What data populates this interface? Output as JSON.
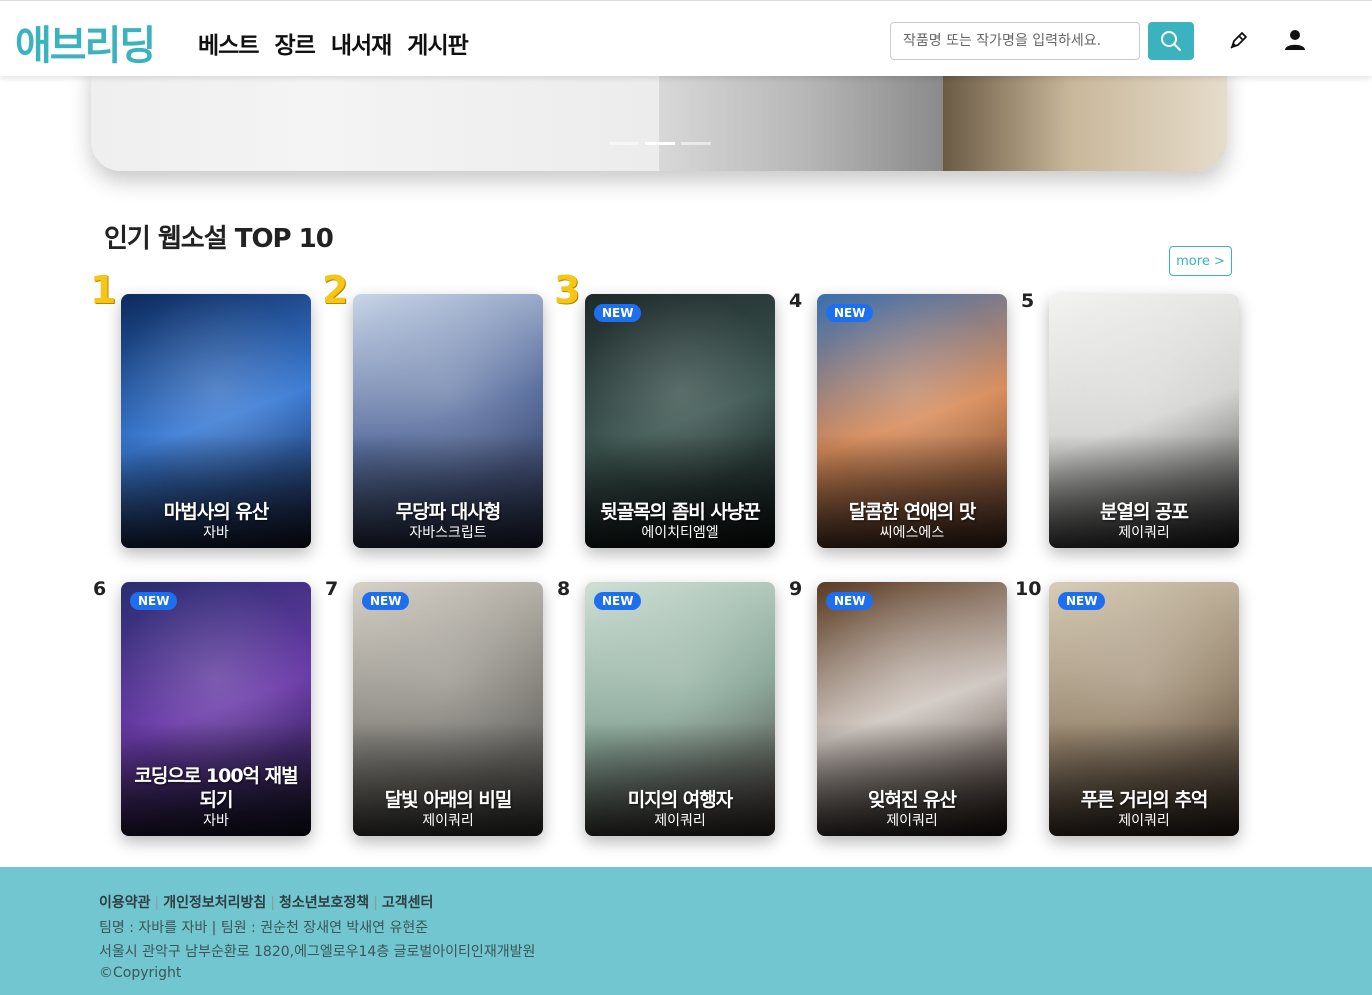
{
  "header": {
    "logo": "애브리딩",
    "nav": [
      "베스트",
      "장르",
      "내서재",
      "게시판"
    ],
    "search_placeholder": "작품명 또는 작가명을 입력하세요."
  },
  "colors": {
    "accent": "#3bb3bf",
    "badge": "#1e6ff0",
    "footer": "#72c6cf",
    "rank_gold": "#f5c518"
  },
  "section": {
    "title": "인기 웹소설 TOP 10",
    "more": "more >"
  },
  "books": [
    {
      "rank": "1",
      "title": "마법사의 유산",
      "author": "자바",
      "new": false,
      "cover": [
        "#0d2a5c",
        "#3a7bd5",
        "#1a1f3a"
      ]
    },
    {
      "rank": "2",
      "title": "무당파 대사형",
      "author": "자바스크립트",
      "new": false,
      "cover": [
        "#c9d6e8",
        "#5a6f9e",
        "#2c3550"
      ]
    },
    {
      "rank": "3",
      "title": "뒷골목의 좀비 사냥꾼",
      "author": "에이치티엠엘",
      "new": true,
      "cover": [
        "#1e2a2a",
        "#3c5550",
        "#141a1a"
      ]
    },
    {
      "rank": "4",
      "title": "달콤한 연애의 맛",
      "author": "씨에스에스",
      "new": true,
      "cover": [
        "#3a6fb0",
        "#d88c5a",
        "#5a3a2a"
      ]
    },
    {
      "rank": "5",
      "title": "분열의 공포",
      "author": "제이쿼리",
      "new": false,
      "cover": [
        "#f3f3f1",
        "#d4d4d2",
        "#2a2a2a"
      ]
    },
    {
      "rank": "6",
      "title": "코딩으로 100억 재벌 되기",
      "author": "자바",
      "new": true,
      "cover": [
        "#2a2d6e",
        "#6a3aa8",
        "#1a1a2e"
      ]
    },
    {
      "rank": "7",
      "title": "달빛 아래의 비밀",
      "author": "제이쿼리",
      "new": true,
      "cover": [
        "#d6d2c8",
        "#8a8780",
        "#4a4a48"
      ]
    },
    {
      "rank": "8",
      "title": "미지의 여행자",
      "author": "제이쿼리",
      "new": true,
      "cover": [
        "#cfe0d6",
        "#8aa89a",
        "#4a3a3a"
      ]
    },
    {
      "rank": "9",
      "title": "잊혀진 유산",
      "author": "제이쿼리",
      "new": true,
      "cover": [
        "#5a3a22",
        "#cfc6c0",
        "#2a1e18"
      ]
    },
    {
      "rank": "10",
      "title": "푸른 거리의 추억",
      "author": "제이쿼리",
      "new": true,
      "cover": [
        "#d8cdb8",
        "#9a8870",
        "#3a2e24"
      ]
    }
  ],
  "badge_label": "NEW",
  "footer": {
    "links": [
      "이용약관",
      "개인정보처리방침",
      "청소년보호정책",
      "고객센터"
    ],
    "team": "팀명 : 자바를 자바 | 팀원 : 권순천 장새연 박새연 유현준",
    "address": "서울시 관악구 남부순환로 1820,에그엘로우14층 글로벌아이티인재개발원",
    "copyright": "©Copyright"
  }
}
